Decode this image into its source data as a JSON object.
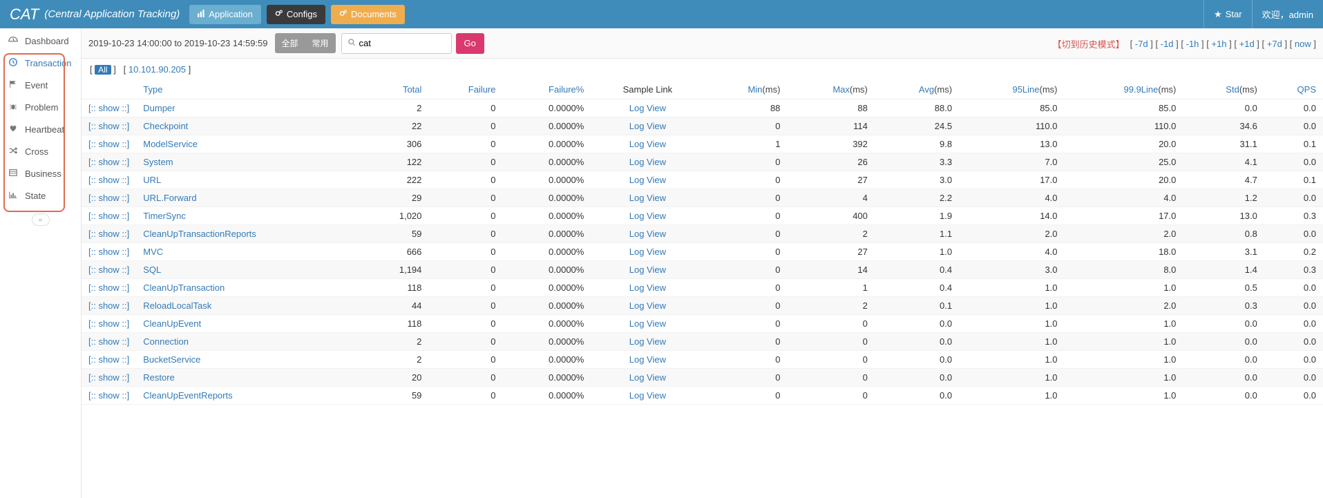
{
  "brand": {
    "name": "CAT",
    "subtitle": "(Central Application Tracking)"
  },
  "topnav": {
    "application": "Application",
    "configs": "Configs",
    "documents": "Documents"
  },
  "topright": {
    "star": "Star",
    "welcome": "欢迎，admin"
  },
  "sidebar": {
    "items": [
      {
        "label": "Dashboard"
      },
      {
        "label": "Transaction"
      },
      {
        "label": "Event"
      },
      {
        "label": "Problem"
      },
      {
        "label": "Heartbeat"
      },
      {
        "label": "Cross"
      },
      {
        "label": "Business"
      },
      {
        "label": "State"
      }
    ]
  },
  "filter": {
    "timerange": "2019-10-23 14:00:00 to 2019-10-23 14:59:59",
    "all": "全部",
    "common": "常用",
    "search_value": "cat",
    "go": "Go"
  },
  "history": {
    "label": "【切到历史模式】",
    "links": [
      "-7d",
      "-1d",
      "-1h",
      "+1h",
      "+1d",
      "+7d",
      "now"
    ]
  },
  "iprow": {
    "all": "All",
    "ip": "10.101.90.205"
  },
  "table": {
    "headers": {
      "type": "Type",
      "total": "Total",
      "failure": "Failure",
      "failurep": "Failure%",
      "sample": "Sample Link",
      "min": "Min",
      "max": "Max",
      "avg": "Avg",
      "line95": "95Line",
      "line999": "99.9Line",
      "std": "Std",
      "qps": "QPS",
      "ms": "(ms)"
    },
    "show": "[:: show ::]",
    "logview": "Log View",
    "rows": [
      {
        "type": "Dumper",
        "total": "2",
        "failure": "0",
        "failurep": "0.0000%",
        "min": "88",
        "max": "88",
        "avg": "88.0",
        "l95": "85.0",
        "l999": "85.0",
        "std": "0.0",
        "qps": "0.0"
      },
      {
        "type": "Checkpoint",
        "total": "22",
        "failure": "0",
        "failurep": "0.0000%",
        "min": "0",
        "max": "114",
        "avg": "24.5",
        "l95": "110.0",
        "l999": "110.0",
        "std": "34.6",
        "qps": "0.0"
      },
      {
        "type": "ModelService",
        "total": "306",
        "failure": "0",
        "failurep": "0.0000%",
        "min": "1",
        "max": "392",
        "avg": "9.8",
        "l95": "13.0",
        "l999": "20.0",
        "std": "31.1",
        "qps": "0.1"
      },
      {
        "type": "System",
        "total": "122",
        "failure": "0",
        "failurep": "0.0000%",
        "min": "0",
        "max": "26",
        "avg": "3.3",
        "l95": "7.0",
        "l999": "25.0",
        "std": "4.1",
        "qps": "0.0"
      },
      {
        "type": "URL",
        "total": "222",
        "failure": "0",
        "failurep": "0.0000%",
        "min": "0",
        "max": "27",
        "avg": "3.0",
        "l95": "17.0",
        "l999": "20.0",
        "std": "4.7",
        "qps": "0.1"
      },
      {
        "type": "URL.Forward",
        "total": "29",
        "failure": "0",
        "failurep": "0.0000%",
        "min": "0",
        "max": "4",
        "avg": "2.2",
        "l95": "4.0",
        "l999": "4.0",
        "std": "1.2",
        "qps": "0.0"
      },
      {
        "type": "TimerSync",
        "total": "1,020",
        "failure": "0",
        "failurep": "0.0000%",
        "min": "0",
        "max": "400",
        "avg": "1.9",
        "l95": "14.0",
        "l999": "17.0",
        "std": "13.0",
        "qps": "0.3"
      },
      {
        "type": "CleanUpTransactionReports",
        "total": "59",
        "failure": "0",
        "failurep": "0.0000%",
        "min": "0",
        "max": "2",
        "avg": "1.1",
        "l95": "2.0",
        "l999": "2.0",
        "std": "0.8",
        "qps": "0.0"
      },
      {
        "type": "MVC",
        "total": "666",
        "failure": "0",
        "failurep": "0.0000%",
        "min": "0",
        "max": "27",
        "avg": "1.0",
        "l95": "4.0",
        "l999": "18.0",
        "std": "3.1",
        "qps": "0.2"
      },
      {
        "type": "SQL",
        "total": "1,194",
        "failure": "0",
        "failurep": "0.0000%",
        "min": "0",
        "max": "14",
        "avg": "0.4",
        "l95": "3.0",
        "l999": "8.0",
        "std": "1.4",
        "qps": "0.3"
      },
      {
        "type": "CleanUpTransaction",
        "total": "118",
        "failure": "0",
        "failurep": "0.0000%",
        "min": "0",
        "max": "1",
        "avg": "0.4",
        "l95": "1.0",
        "l999": "1.0",
        "std": "0.5",
        "qps": "0.0"
      },
      {
        "type": "ReloadLocalTask",
        "total": "44",
        "failure": "0",
        "failurep": "0.0000%",
        "min": "0",
        "max": "2",
        "avg": "0.1",
        "l95": "1.0",
        "l999": "2.0",
        "std": "0.3",
        "qps": "0.0"
      },
      {
        "type": "CleanUpEvent",
        "total": "118",
        "failure": "0",
        "failurep": "0.0000%",
        "min": "0",
        "max": "0",
        "avg": "0.0",
        "l95": "1.0",
        "l999": "1.0",
        "std": "0.0",
        "qps": "0.0"
      },
      {
        "type": "Connection",
        "total": "2",
        "failure": "0",
        "failurep": "0.0000%",
        "min": "0",
        "max": "0",
        "avg": "0.0",
        "l95": "1.0",
        "l999": "1.0",
        "std": "0.0",
        "qps": "0.0"
      },
      {
        "type": "BucketService",
        "total": "2",
        "failure": "0",
        "failurep": "0.0000%",
        "min": "0",
        "max": "0",
        "avg": "0.0",
        "l95": "1.0",
        "l999": "1.0",
        "std": "0.0",
        "qps": "0.0"
      },
      {
        "type": "Restore",
        "total": "20",
        "failure": "0",
        "failurep": "0.0000%",
        "min": "0",
        "max": "0",
        "avg": "0.0",
        "l95": "1.0",
        "l999": "1.0",
        "std": "0.0",
        "qps": "0.0"
      },
      {
        "type": "CleanUpEventReports",
        "total": "59",
        "failure": "0",
        "failurep": "0.0000%",
        "min": "0",
        "max": "0",
        "avg": "0.0",
        "l95": "1.0",
        "l999": "1.0",
        "std": "0.0",
        "qps": "0.0"
      }
    ]
  }
}
